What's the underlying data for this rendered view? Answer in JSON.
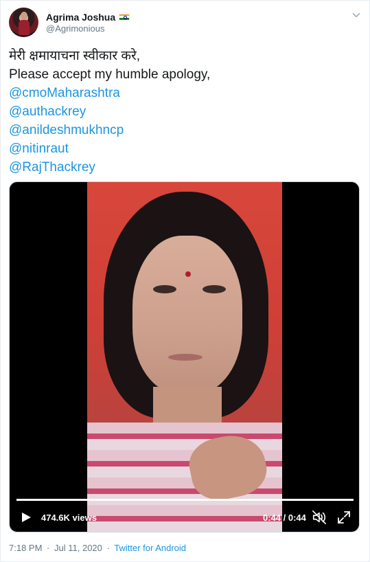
{
  "user": {
    "display_name": "Agrima Joshua",
    "handle": "@Agrimonious",
    "flag_icon": "india-flag-icon"
  },
  "tweet": {
    "lines": [
      "मेरी क्षमायाचना स्वीकार करे,",
      "Please accept my humble apology,"
    ],
    "mentions": [
      "@cmoMaharashtra",
      "@authackrey",
      "@anildeshmukhncp",
      "@nitinraut",
      "@RajThackrey"
    ]
  },
  "video": {
    "views": "474.6K views",
    "time": "0:44 / 0:44",
    "progress": 1.0
  },
  "footer": {
    "time": "7:18 PM",
    "separator": "·",
    "date": "Jul 11, 2020",
    "source": "Twitter for Android"
  },
  "colors": {
    "link": "#1b95e0",
    "text": "#14171a",
    "muted": "#657786"
  }
}
